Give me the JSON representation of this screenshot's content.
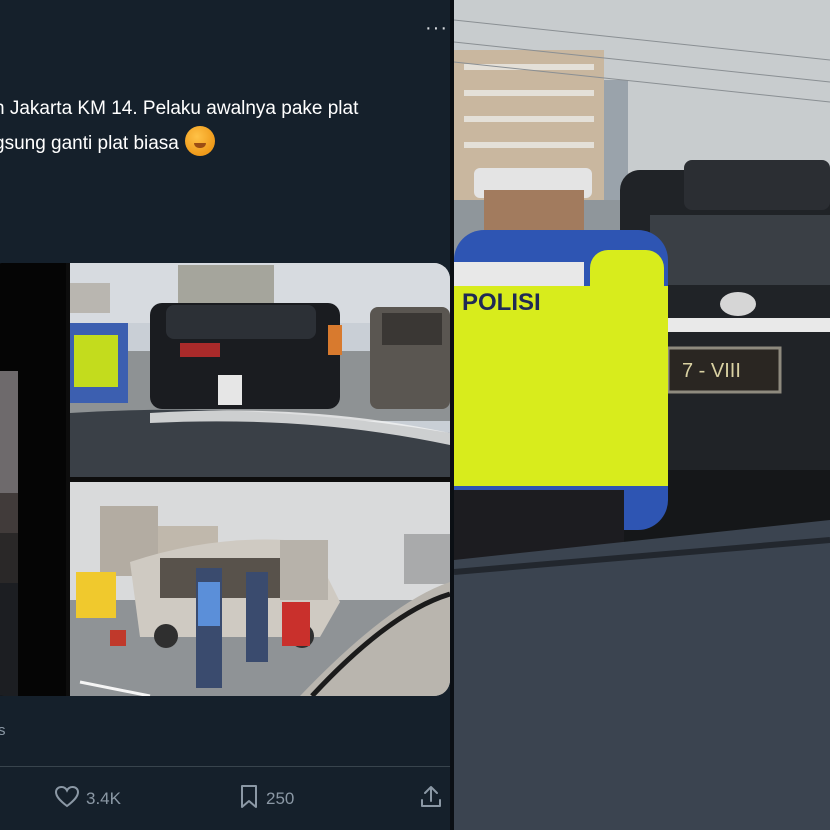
{
  "tweet": {
    "more_icon": "more-horizontal-icon",
    "text_lines": [
      "h Jakarta KM 14. Pelaku awalnya pake plat",
      "gsung ganti plat biasa"
    ],
    "emoji": "sweating-face-emoji",
    "meta_fragment": "s"
  },
  "photos": {
    "police_vest_text": "POLISI",
    "plate_text": "7 - VIII"
  },
  "actions": {
    "like_icon": "heart-icon",
    "like_count": "3.4K",
    "bookmark_icon": "bookmark-icon",
    "bookmark_count": "250",
    "share_icon": "share-icon"
  },
  "colors": {
    "background": "#15202b",
    "text": "#ffffff",
    "muted": "#8b98a5",
    "separator": "#38444d"
  }
}
